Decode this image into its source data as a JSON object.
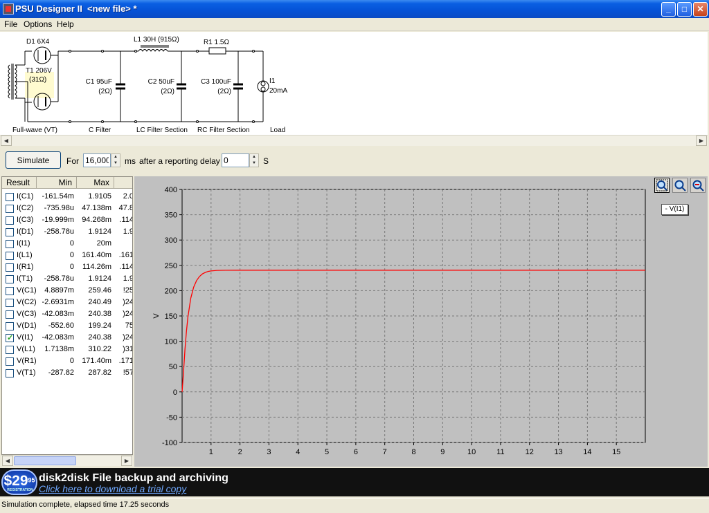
{
  "window": {
    "title": "PSU Designer II  <new file> *",
    "minimize": "_",
    "maximize": "□",
    "close": "✕"
  },
  "menu": [
    "File",
    "Options",
    "Help"
  ],
  "circuit": {
    "d1": "D1 6X4",
    "t1_line1": "T1 206V",
    "t1_line2": "(31Ω)",
    "l1": "L1 30H (915Ω)",
    "r1": "R1 1.5Ω",
    "c1_value": "C1 95uF",
    "c1_esr": "(2Ω)",
    "c2_value": "C2 50uF",
    "c2_esr": "(2Ω)",
    "c3_value": "C3 100uF",
    "c3_esr": "(2Ω)",
    "i1_name": "I1",
    "i1_value": "20mA",
    "sections": {
      "rectifier": "Full-wave (VT)",
      "c_filter": "C Filter",
      "lc_filter": "LC Filter Section",
      "rc_filter": "RC Filter Section",
      "load": "Load"
    }
  },
  "controls": {
    "simulate": "Simulate",
    "for_label": "For",
    "duration": "16,000",
    "ms_label": "ms",
    "delay_label": "after a reporting delay of",
    "delay": "0",
    "s_label": "S"
  },
  "results": {
    "headers": [
      "Result",
      "Min",
      "Max"
    ],
    "rows": [
      {
        "name": "I(C1)",
        "min": "-161.54m",
        "max": "1.9105",
        "extra": "2.0",
        "checked": false
      },
      {
        "name": "I(C2)",
        "min": "-735.98u",
        "max": "47.138m",
        "extra": "47.8",
        "checked": false
      },
      {
        "name": "I(C3)",
        "min": "-19.999m",
        "max": "94.268m",
        "extra": "114.",
        "checked": false
      },
      {
        "name": "I(D1)",
        "min": "-258.78u",
        "max": "1.9124",
        "extra": "1.9",
        "checked": false
      },
      {
        "name": "I(I1)",
        "min": "0",
        "max": "20m",
        "extra": "",
        "checked": false
      },
      {
        "name": "I(L1)",
        "min": "0",
        "max": "161.40m",
        "extra": "161.",
        "checked": false
      },
      {
        "name": "I(R1)",
        "min": "0",
        "max": "114.26m",
        "extra": "114.",
        "checked": false
      },
      {
        "name": "I(T1)",
        "min": "-258.78u",
        "max": "1.9124",
        "extra": "1.9",
        "checked": false
      },
      {
        "name": "V(C1)",
        "min": "4.8897m",
        "max": "259.46",
        "extra": "25!",
        "checked": false
      },
      {
        "name": "V(C2)",
        "min": "-2.6931m",
        "max": "240.49",
        "extra": "24(",
        "checked": false
      },
      {
        "name": "V(C3)",
        "min": "-42.083m",
        "max": "240.38",
        "extra": "24(",
        "checked": false
      },
      {
        "name": "V(D1)",
        "min": "-552.60",
        "max": "199.24",
        "extra": "75",
        "checked": false
      },
      {
        "name": "V(I1)",
        "min": "-42.083m",
        "max": "240.38",
        "extra": "24(",
        "checked": true
      },
      {
        "name": "V(L1)",
        "min": "1.7138m",
        "max": "310.22",
        "extra": "31(",
        "checked": false
      },
      {
        "name": "V(R1)",
        "min": "0",
        "max": "171.40m",
        "extra": "171.",
        "checked": false
      },
      {
        "name": "V(T1)",
        "min": "-287.82",
        "max": "287.82",
        "extra": "57!",
        "checked": false
      }
    ]
  },
  "chart_data": {
    "type": "line",
    "title": "",
    "xlabel": "",
    "ylabel": "V",
    "xlim": [
      0,
      16
    ],
    "ylim": [
      -100,
      400
    ],
    "xticks": [
      1,
      2,
      3,
      4,
      5,
      6,
      7,
      8,
      9,
      10,
      11,
      12,
      13,
      14,
      15
    ],
    "yticks": [
      -100,
      -50,
      0,
      50,
      100,
      150,
      200,
      250,
      300,
      350,
      400
    ],
    "grid": true,
    "legend_position": "top-right outside",
    "legend_label": "- V(I1)",
    "line_color": "#ff0000",
    "series": [
      {
        "name": "V(I1)",
        "x": [
          0,
          0.05,
          0.1,
          0.15,
          0.2,
          0.3,
          0.4,
          0.5,
          0.6,
          0.7,
          0.8,
          0.9,
          1.0,
          1.2,
          1.5,
          2.0,
          3,
          4,
          5,
          6,
          7,
          8,
          9,
          10,
          11,
          12,
          13,
          14,
          15,
          16
        ],
        "y": [
          0,
          40,
          85,
          120,
          148,
          185,
          207,
          220,
          228,
          233,
          236,
          238,
          239,
          240,
          240.3,
          240.38,
          240.38,
          240.38,
          240.38,
          240.38,
          240.38,
          240.38,
          240.38,
          240.38,
          240.38,
          240.38,
          240.38,
          240.38,
          240.38,
          240.38
        ]
      }
    ]
  },
  "banner": {
    "price": "$29",
    "price_cents": "95",
    "badge_sub": "REGISTRATION",
    "title": "disk2disk File backup and archiving",
    "link": "Click here to download a trial copy"
  },
  "status": "Simulation complete, elapsed time 17.25 seconds"
}
